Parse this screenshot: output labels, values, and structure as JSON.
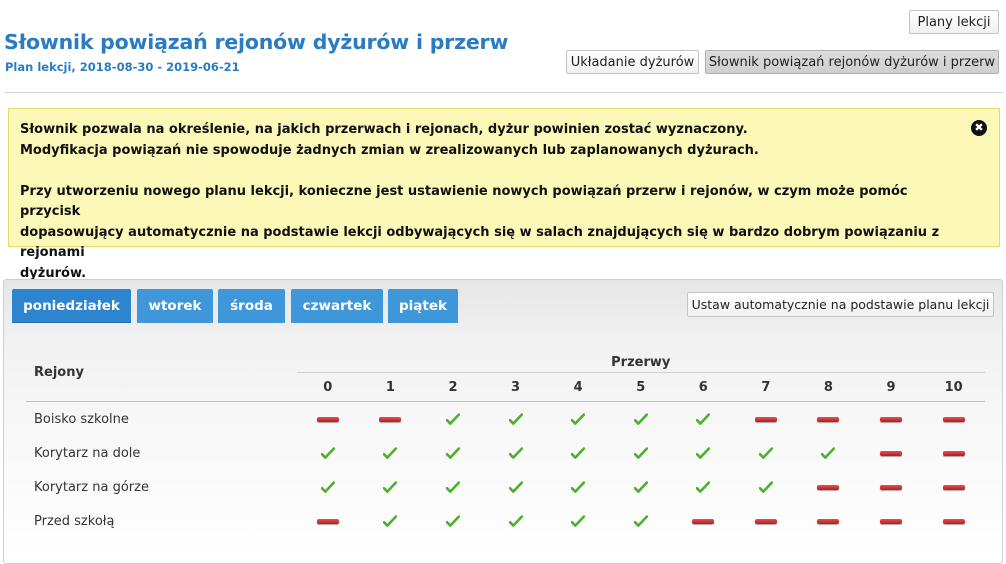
{
  "header": {
    "title": "Słownik powiązań rejonów dyżurów i przerw",
    "subtitle": "Plan lekcji, 2018-08-30 - 2019-06-21",
    "plany_button": "Plany lekcji",
    "ukladanie_button": "Układanie dyżurów",
    "slownik_button": "Słownik powiązań rejonów dyżurów i przerw"
  },
  "alert": {
    "line1": "Słownik pozwala na określenie, na jakich przerwach i rejonach, dyżur powinien zostać wyznaczony.",
    "line2": "Modyfikacja powiązań nie spowoduje żadnych zmian w zrealizowanych lub zaplanowanych dyżurach.",
    "line3": "Przy utworzeniu nowego planu lekcji, konieczne jest ustawienie nowych powiązań przerw i rejonów, w czym może pomóc przycisk",
    "line4": "dopasowujący automatycznie na podstawie lekcji odbywających się w salach znajdujących się w bardzo dobrym powiązaniu z rejonami",
    "line5": "dyżurów.",
    "close_glyph": "✖"
  },
  "tabs": {
    "items": [
      "poniedziałek",
      "wtorek",
      "środa",
      "czwartek",
      "piątek"
    ],
    "active": "poniedziałek"
  },
  "auto_button": "Ustaw automatycznie na podstawie planu lekcji",
  "table": {
    "rejony_header": "Rejony",
    "przerwy_header": "Przerwy",
    "breaks": [
      "0",
      "1",
      "2",
      "3",
      "4",
      "5",
      "6",
      "7",
      "8",
      "9",
      "10"
    ],
    "rows": [
      {
        "name": "Boisko szkolne",
        "values": [
          0,
          0,
          1,
          1,
          1,
          1,
          1,
          0,
          0,
          0,
          0
        ]
      },
      {
        "name": "Korytarz na dole",
        "values": [
          1,
          1,
          1,
          1,
          1,
          1,
          1,
          1,
          1,
          0,
          0
        ]
      },
      {
        "name": "Korytarz na górze",
        "values": [
          1,
          1,
          1,
          1,
          1,
          1,
          1,
          1,
          0,
          0,
          0
        ]
      },
      {
        "name": "Przed szkołą",
        "values": [
          0,
          1,
          1,
          1,
          1,
          1,
          0,
          0,
          0,
          0,
          0
        ]
      }
    ]
  },
  "colors": {
    "accent": "#2a7bc0",
    "tab": "#3f97d9",
    "alert_bg": "#fbf8b8",
    "ok": "#4caf2e",
    "no": "#c62828"
  }
}
